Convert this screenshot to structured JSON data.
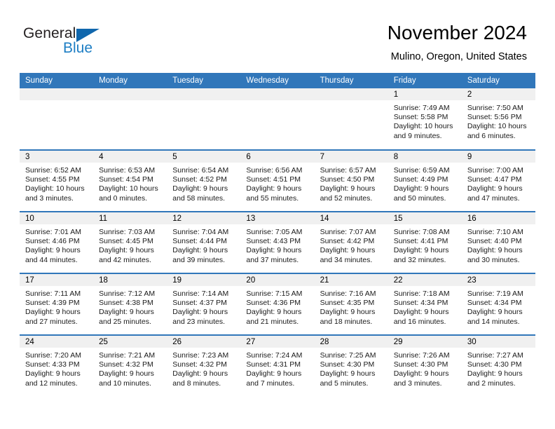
{
  "brand": {
    "name_part1": "General",
    "name_part2": "Blue",
    "triangle_color": "#1067ad",
    "blue_color": "#1d7ec4"
  },
  "header": {
    "title": "November 2024",
    "subtitle": "Mulino, Oregon, United States",
    "header_bg": "#3177ba",
    "daynum_bg": "#f0f0f0"
  },
  "weekdays": [
    "Sunday",
    "Monday",
    "Tuesday",
    "Wednesday",
    "Thursday",
    "Friday",
    "Saturday"
  ],
  "weeks": [
    [
      {
        "day": "",
        "sunrise": "",
        "sunset": "",
        "daylight": ""
      },
      {
        "day": "",
        "sunrise": "",
        "sunset": "",
        "daylight": ""
      },
      {
        "day": "",
        "sunrise": "",
        "sunset": "",
        "daylight": ""
      },
      {
        "day": "",
        "sunrise": "",
        "sunset": "",
        "daylight": ""
      },
      {
        "day": "",
        "sunrise": "",
        "sunset": "",
        "daylight": ""
      },
      {
        "day": "1",
        "sunrise": "Sunrise: 7:49 AM",
        "sunset": "Sunset: 5:58 PM",
        "daylight": "Daylight: 10 hours and 9 minutes."
      },
      {
        "day": "2",
        "sunrise": "Sunrise: 7:50 AM",
        "sunset": "Sunset: 5:56 PM",
        "daylight": "Daylight: 10 hours and 6 minutes."
      }
    ],
    [
      {
        "day": "3",
        "sunrise": "Sunrise: 6:52 AM",
        "sunset": "Sunset: 4:55 PM",
        "daylight": "Daylight: 10 hours and 3 minutes."
      },
      {
        "day": "4",
        "sunrise": "Sunrise: 6:53 AM",
        "sunset": "Sunset: 4:54 PM",
        "daylight": "Daylight: 10 hours and 0 minutes."
      },
      {
        "day": "5",
        "sunrise": "Sunrise: 6:54 AM",
        "sunset": "Sunset: 4:52 PM",
        "daylight": "Daylight: 9 hours and 58 minutes."
      },
      {
        "day": "6",
        "sunrise": "Sunrise: 6:56 AM",
        "sunset": "Sunset: 4:51 PM",
        "daylight": "Daylight: 9 hours and 55 minutes."
      },
      {
        "day": "7",
        "sunrise": "Sunrise: 6:57 AM",
        "sunset": "Sunset: 4:50 PM",
        "daylight": "Daylight: 9 hours and 52 minutes."
      },
      {
        "day": "8",
        "sunrise": "Sunrise: 6:59 AM",
        "sunset": "Sunset: 4:49 PM",
        "daylight": "Daylight: 9 hours and 50 minutes."
      },
      {
        "day": "9",
        "sunrise": "Sunrise: 7:00 AM",
        "sunset": "Sunset: 4:47 PM",
        "daylight": "Daylight: 9 hours and 47 minutes."
      }
    ],
    [
      {
        "day": "10",
        "sunrise": "Sunrise: 7:01 AM",
        "sunset": "Sunset: 4:46 PM",
        "daylight": "Daylight: 9 hours and 44 minutes."
      },
      {
        "day": "11",
        "sunrise": "Sunrise: 7:03 AM",
        "sunset": "Sunset: 4:45 PM",
        "daylight": "Daylight: 9 hours and 42 minutes."
      },
      {
        "day": "12",
        "sunrise": "Sunrise: 7:04 AM",
        "sunset": "Sunset: 4:44 PM",
        "daylight": "Daylight: 9 hours and 39 minutes."
      },
      {
        "day": "13",
        "sunrise": "Sunrise: 7:05 AM",
        "sunset": "Sunset: 4:43 PM",
        "daylight": "Daylight: 9 hours and 37 minutes."
      },
      {
        "day": "14",
        "sunrise": "Sunrise: 7:07 AM",
        "sunset": "Sunset: 4:42 PM",
        "daylight": "Daylight: 9 hours and 34 minutes."
      },
      {
        "day": "15",
        "sunrise": "Sunrise: 7:08 AM",
        "sunset": "Sunset: 4:41 PM",
        "daylight": "Daylight: 9 hours and 32 minutes."
      },
      {
        "day": "16",
        "sunrise": "Sunrise: 7:10 AM",
        "sunset": "Sunset: 4:40 PM",
        "daylight": "Daylight: 9 hours and 30 minutes."
      }
    ],
    [
      {
        "day": "17",
        "sunrise": "Sunrise: 7:11 AM",
        "sunset": "Sunset: 4:39 PM",
        "daylight": "Daylight: 9 hours and 27 minutes."
      },
      {
        "day": "18",
        "sunrise": "Sunrise: 7:12 AM",
        "sunset": "Sunset: 4:38 PM",
        "daylight": "Daylight: 9 hours and 25 minutes."
      },
      {
        "day": "19",
        "sunrise": "Sunrise: 7:14 AM",
        "sunset": "Sunset: 4:37 PM",
        "daylight": "Daylight: 9 hours and 23 minutes."
      },
      {
        "day": "20",
        "sunrise": "Sunrise: 7:15 AM",
        "sunset": "Sunset: 4:36 PM",
        "daylight": "Daylight: 9 hours and 21 minutes."
      },
      {
        "day": "21",
        "sunrise": "Sunrise: 7:16 AM",
        "sunset": "Sunset: 4:35 PM",
        "daylight": "Daylight: 9 hours and 18 minutes."
      },
      {
        "day": "22",
        "sunrise": "Sunrise: 7:18 AM",
        "sunset": "Sunset: 4:34 PM",
        "daylight": "Daylight: 9 hours and 16 minutes."
      },
      {
        "day": "23",
        "sunrise": "Sunrise: 7:19 AM",
        "sunset": "Sunset: 4:34 PM",
        "daylight": "Daylight: 9 hours and 14 minutes."
      }
    ],
    [
      {
        "day": "24",
        "sunrise": "Sunrise: 7:20 AM",
        "sunset": "Sunset: 4:33 PM",
        "daylight": "Daylight: 9 hours and 12 minutes."
      },
      {
        "day": "25",
        "sunrise": "Sunrise: 7:21 AM",
        "sunset": "Sunset: 4:32 PM",
        "daylight": "Daylight: 9 hours and 10 minutes."
      },
      {
        "day": "26",
        "sunrise": "Sunrise: 7:23 AM",
        "sunset": "Sunset: 4:32 PM",
        "daylight": "Daylight: 9 hours and 8 minutes."
      },
      {
        "day": "27",
        "sunrise": "Sunrise: 7:24 AM",
        "sunset": "Sunset: 4:31 PM",
        "daylight": "Daylight: 9 hours and 7 minutes."
      },
      {
        "day": "28",
        "sunrise": "Sunrise: 7:25 AM",
        "sunset": "Sunset: 4:30 PM",
        "daylight": "Daylight: 9 hours and 5 minutes."
      },
      {
        "day": "29",
        "sunrise": "Sunrise: 7:26 AM",
        "sunset": "Sunset: 4:30 PM",
        "daylight": "Daylight: 9 hours and 3 minutes."
      },
      {
        "day": "30",
        "sunrise": "Sunrise: 7:27 AM",
        "sunset": "Sunset: 4:30 PM",
        "daylight": "Daylight: 9 hours and 2 minutes."
      }
    ]
  ]
}
